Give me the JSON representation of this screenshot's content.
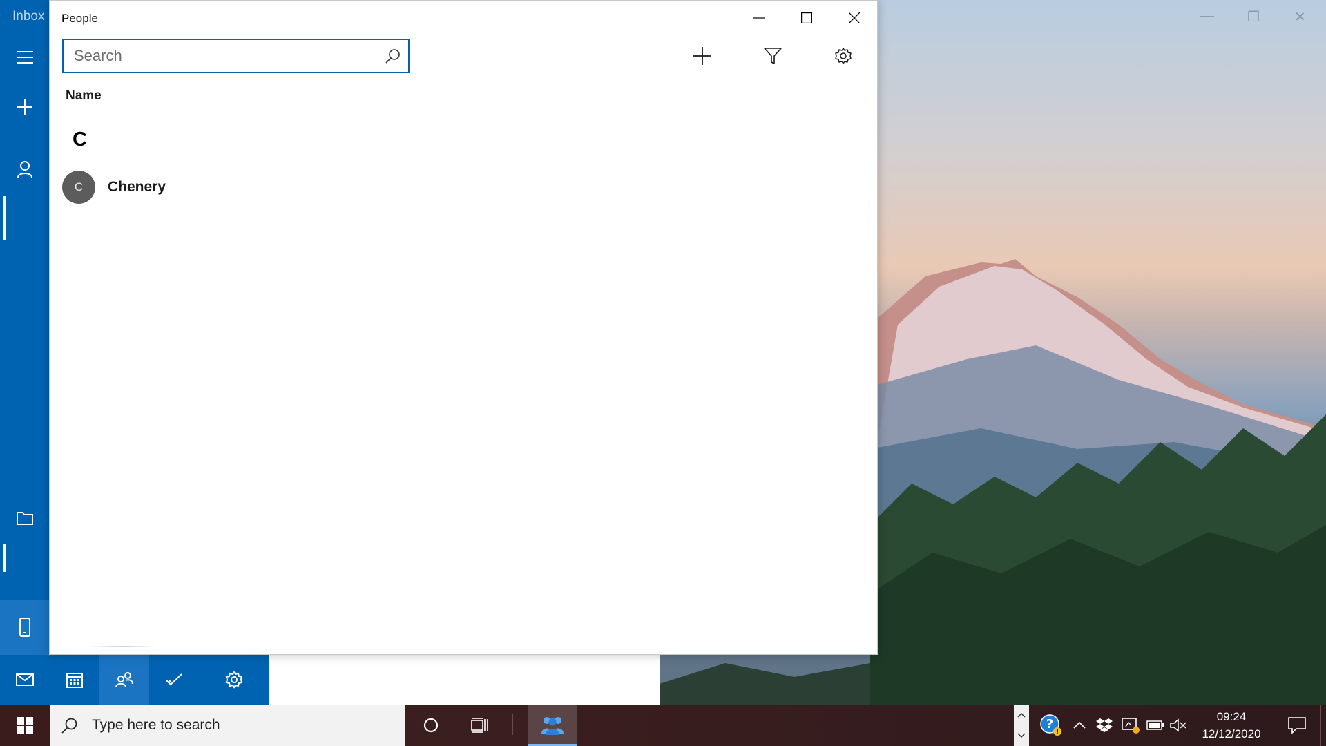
{
  "mail": {
    "inbox_label": "Inbox"
  },
  "people": {
    "title": "People",
    "search": {
      "placeholder": "Search",
      "value": ""
    },
    "column_header": "Name",
    "groups": [
      {
        "letter": "C",
        "contacts": [
          {
            "initial": "C",
            "name": "Chenery"
          }
        ]
      }
    ]
  },
  "taskbar": {
    "search_text": "Type here to search",
    "time": "09:24",
    "date": "12/12/2020"
  },
  "colors": {
    "accent": "#0063b1",
    "avatar_bg": "#5c5c5c"
  },
  "icons": {
    "add": "plus-icon",
    "filter": "filter-icon",
    "settings": "gear-icon",
    "search": "search-icon"
  }
}
